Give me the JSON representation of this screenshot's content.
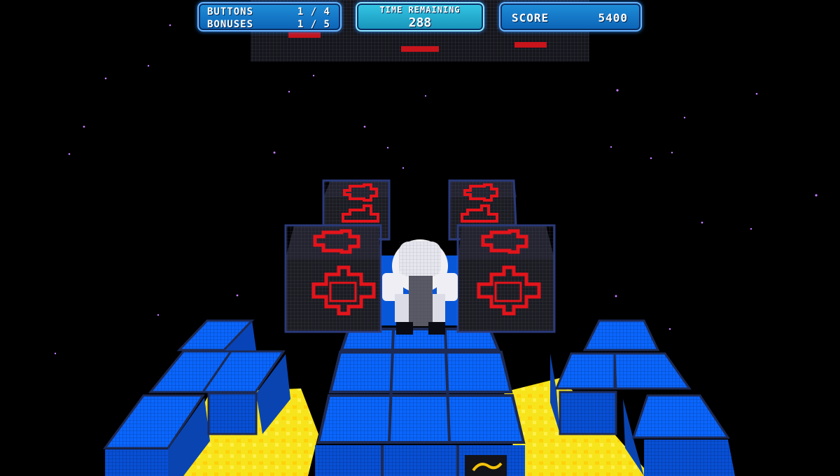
{
  "hud": {
    "buttons_label": "BUTTONS",
    "buttons_value": "1 / 4",
    "bonuses_label": "BONUSES",
    "bonuses_value": "1 / 5",
    "time_label": "TIME REMAINING",
    "time_value": "288",
    "score_label": "SCORE",
    "score_value": "5400"
  },
  "colors": {
    "background": "#000000",
    "floor_tile": "#0a66ff",
    "tile_edge": "#1c2a55",
    "hazard_block": "#1b1b22",
    "hazard_symbol": "#e3141b",
    "lava": "#f5e20a",
    "player": "#f0f0f4",
    "hud_panel": "#1378cc"
  },
  "scene": {
    "player": "robot-player",
    "hazard_blocks": 4,
    "floor": "blue-tile-grid",
    "hazard_surface": "yellow-lava"
  }
}
